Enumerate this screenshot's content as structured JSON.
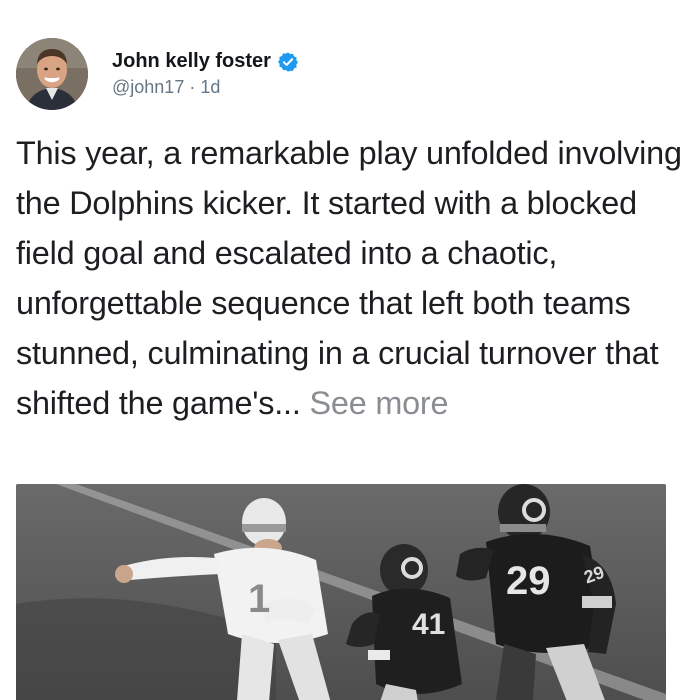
{
  "author": {
    "display_name": "John kelly foster",
    "verified": true,
    "verified_color": "#1d9bf0",
    "handle": "@john17",
    "separator": " · ",
    "time_ago": "1d",
    "avatar_icon": "profile-photo"
  },
  "post": {
    "text": "This year, a remarkable play unfolded involving the Dolphins kicker. It started with a blocked field goal and escalated into a chaotic, unforgettable sequence that left both teams stunned, culminating in a crucial turnover that shifted the game's...",
    "see_more_label": "See more"
  },
  "media": {
    "type": "photo",
    "style": "black-and-white",
    "jersey_numbers": [
      "1",
      "41",
      "29"
    ],
    "sleeve_number": "29"
  },
  "colors": {
    "text": "#1c1e21",
    "secondary_text": "#657786",
    "see_more": "#8a8d91"
  }
}
